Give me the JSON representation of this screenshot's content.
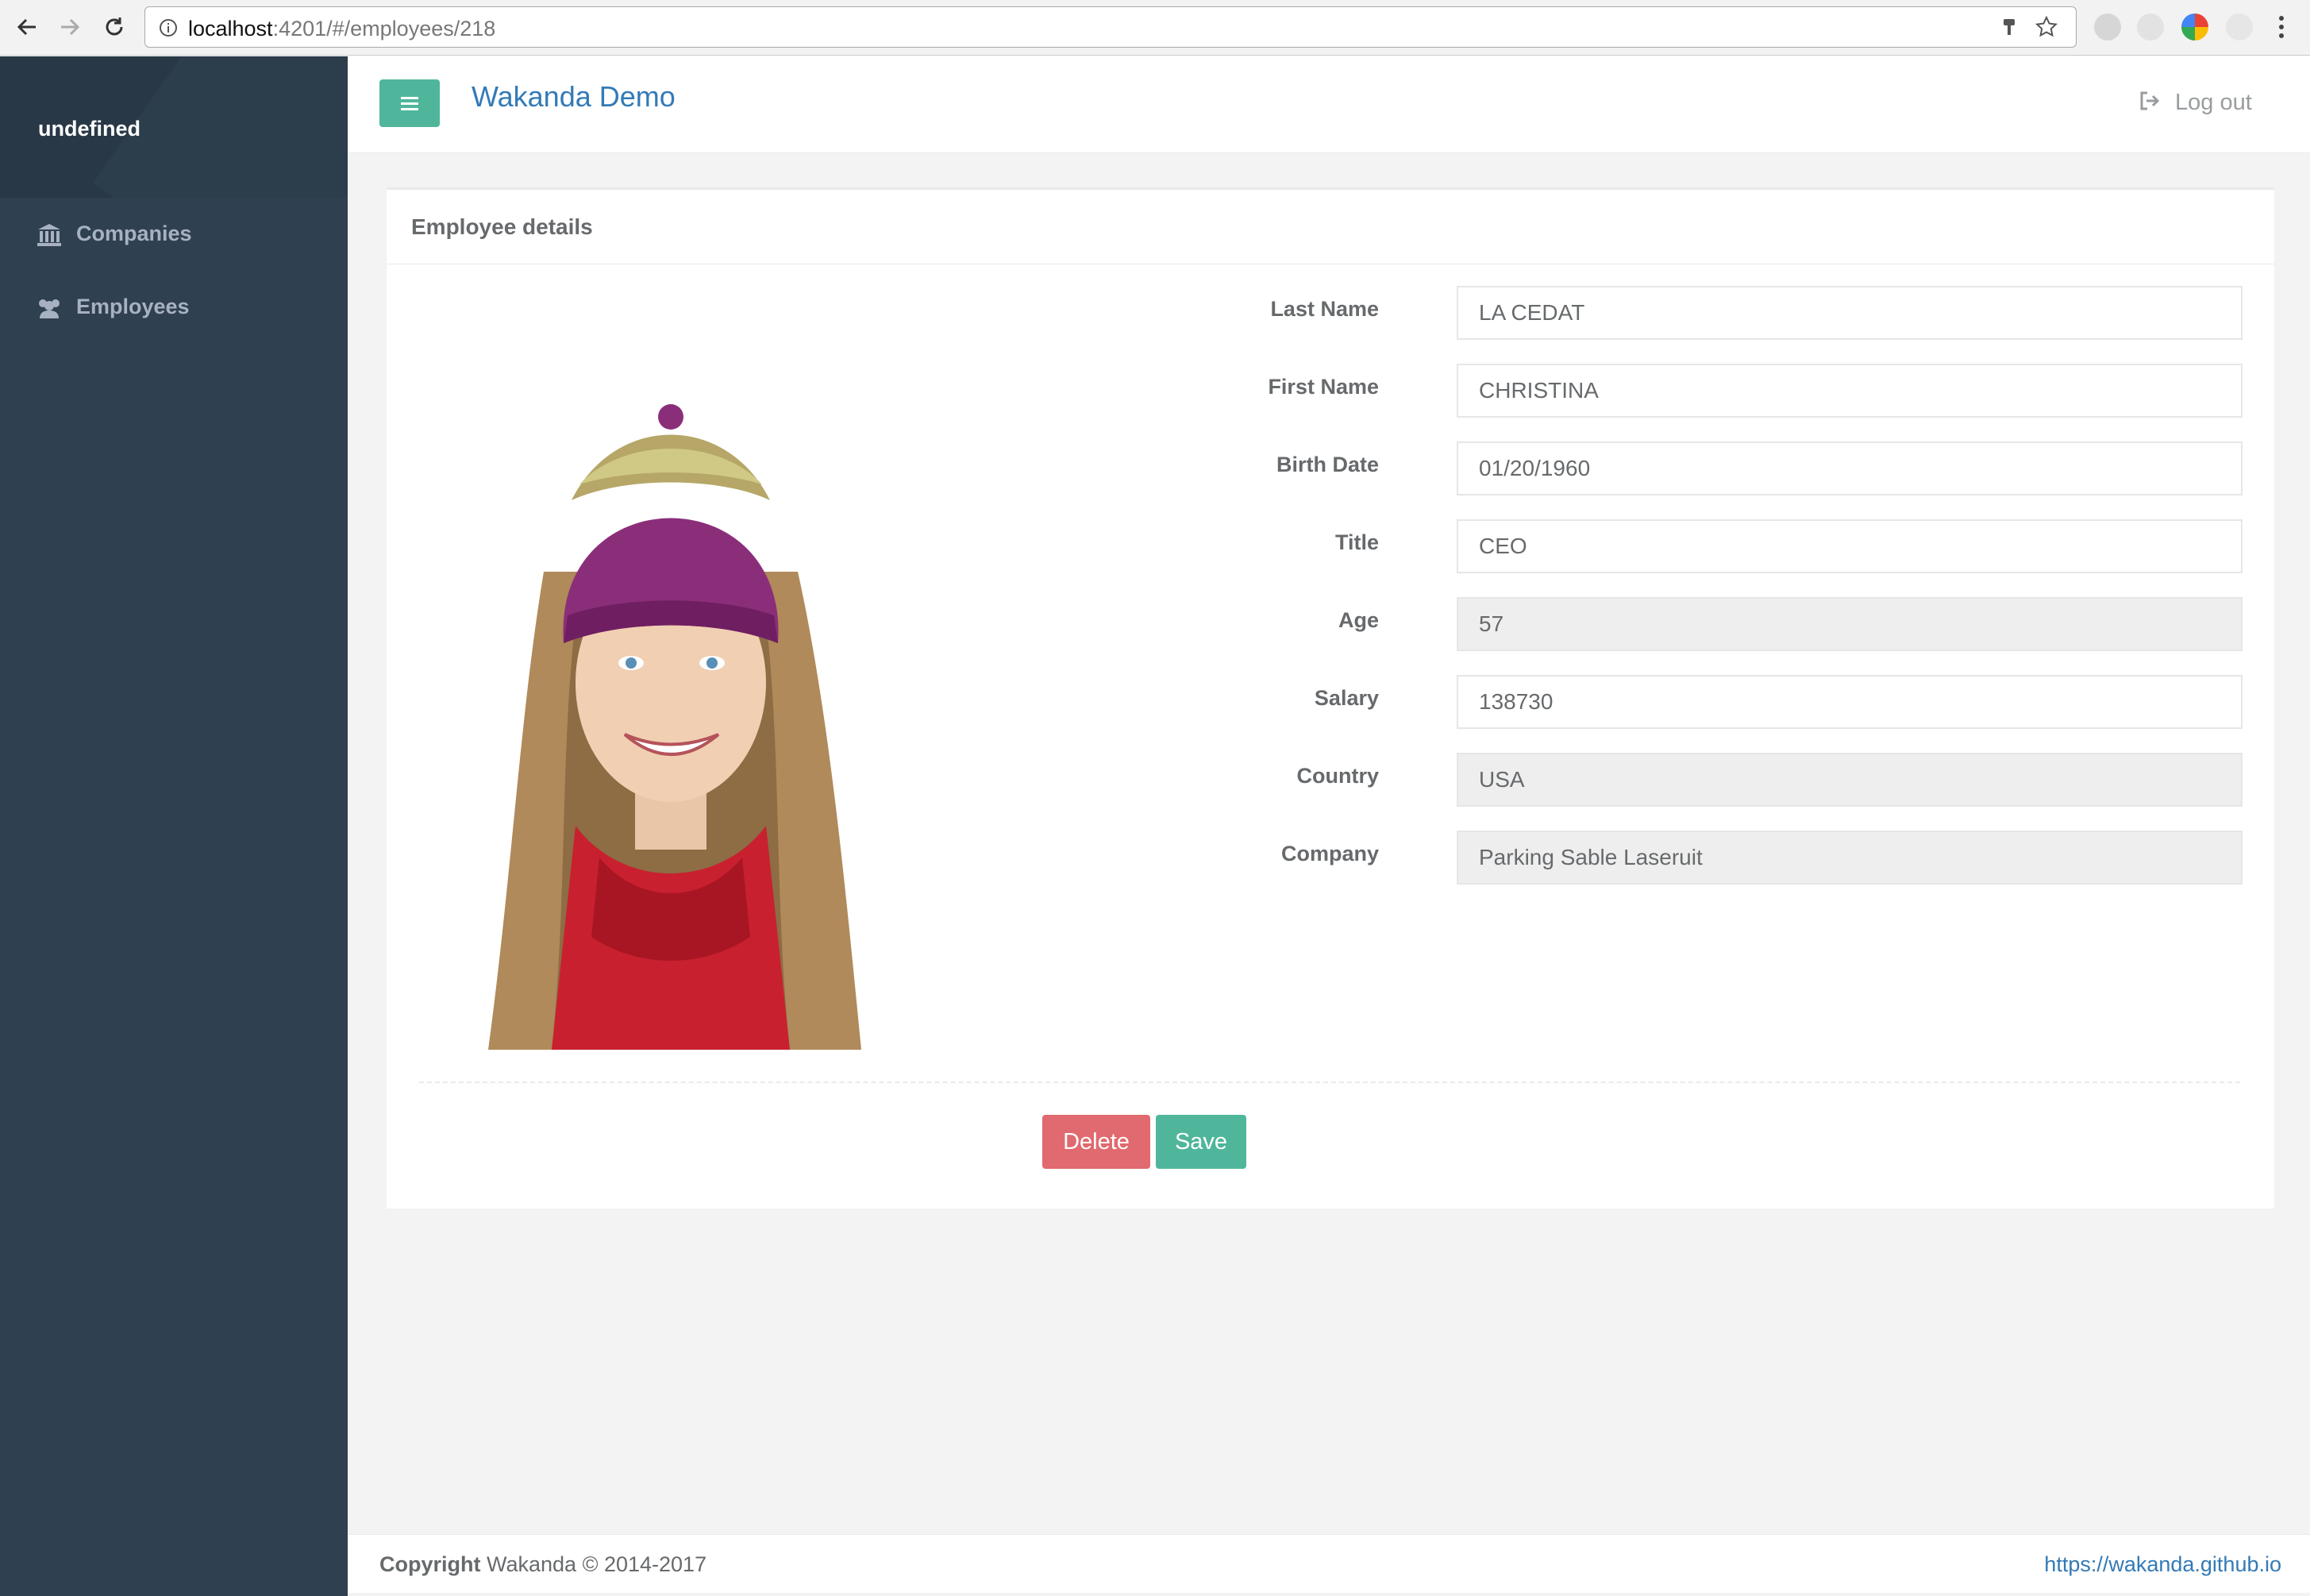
{
  "browser": {
    "url_host": "localhost",
    "url_path": ":4201/#/employees/218"
  },
  "sidebar": {
    "profile_name": "undefined",
    "items": [
      {
        "label": "Companies",
        "icon": "bank-icon"
      },
      {
        "label": "Employees",
        "icon": "users-icon"
      }
    ]
  },
  "navbar": {
    "brand": "Wakanda Demo",
    "logout": "Log out"
  },
  "panel": {
    "title": "Employee details",
    "fields": [
      {
        "label": "Last Name",
        "value": "LA CEDAT",
        "readonly": false
      },
      {
        "label": "First Name",
        "value": "CHRISTINA",
        "readonly": false
      },
      {
        "label": "Birth Date",
        "value": "01/20/1960",
        "readonly": false
      },
      {
        "label": "Title",
        "value": "CEO",
        "readonly": false
      },
      {
        "label": "Age",
        "value": "57",
        "readonly": true
      },
      {
        "label": "Salary",
        "value": "138730",
        "readonly": false
      },
      {
        "label": "Country",
        "value": "USA",
        "readonly": true
      },
      {
        "label": "Company",
        "value": "Parking Sable Laseruit",
        "readonly": true
      }
    ],
    "delete_label": "Delete",
    "save_label": "Save"
  },
  "footer": {
    "copyright_bold": "Copyright",
    "copyright_text": " Wakanda © 2014-2017",
    "link": "https://wakanda.github.io"
  },
  "colors": {
    "sidebar": "#2f4050",
    "accent": "#4fb69b",
    "danger": "#e06a6f",
    "link": "#337ab7"
  }
}
